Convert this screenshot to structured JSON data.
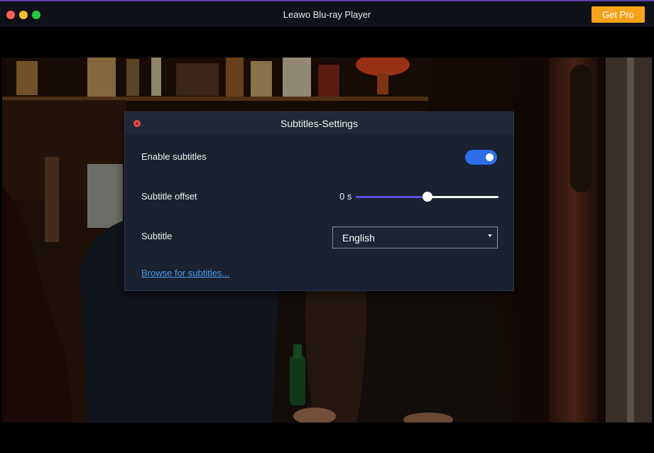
{
  "window": {
    "title": "Leawo Blu-ray Player",
    "get_pro_label": "Get Pro"
  },
  "dialog": {
    "title": "Subtitles-Settings",
    "enable_label": "Enable subtitles",
    "enable_on": true,
    "offset_label": "Subtitle offset",
    "offset_value": "0 s",
    "offset_slider_fraction": 0.5,
    "subtitle_label": "Subtitle",
    "subtitle_selected": "English",
    "browse_label": "Browse for subtitles..."
  },
  "colors": {
    "accent": "#2c6ee8",
    "get_pro": "#f7a21b",
    "slider_fill": "#5b4de0",
    "link": "#4a9bea"
  }
}
